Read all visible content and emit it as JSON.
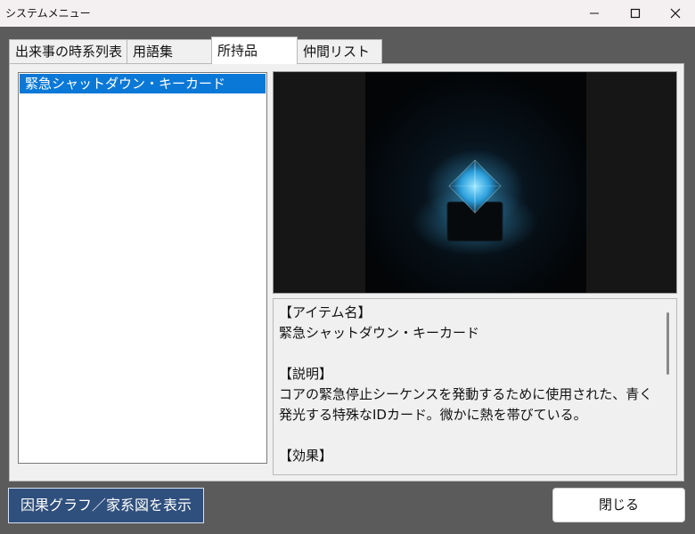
{
  "window": {
    "title": "システムメニュー",
    "controls": {
      "minimize_icon": "minimize-icon",
      "maximize_icon": "maximize-icon",
      "close_icon": "close-icon"
    }
  },
  "tabs": [
    {
      "label": "出来事の時系列表",
      "active": false
    },
    {
      "label": "用語集",
      "active": false
    },
    {
      "label": "所持品",
      "active": true
    },
    {
      "label": "仲間リスト",
      "active": false
    }
  ],
  "inventory": {
    "items": [
      {
        "label": "緊急シャットダウン・キーカード",
        "selected": true
      }
    ],
    "preview": {
      "icon": "glowing-blue-crystal-keycard",
      "colors": {
        "background": "#0b0b0b",
        "glow": "#39a7e0"
      }
    },
    "description_lines": [
      "【アイテム名】",
      "緊急シャットダウン・キーカード",
      "",
      "【説明】",
      "コアの緊急停止シーケンスを発動するために使用された、青く",
      "発光する特殊なIDカード。微かに熱を帯びている。",
      "",
      "【効果】"
    ]
  },
  "footer": {
    "cause_button_label": "因果グラフ／家系図を表示",
    "close_button_label": "閉じる"
  }
}
